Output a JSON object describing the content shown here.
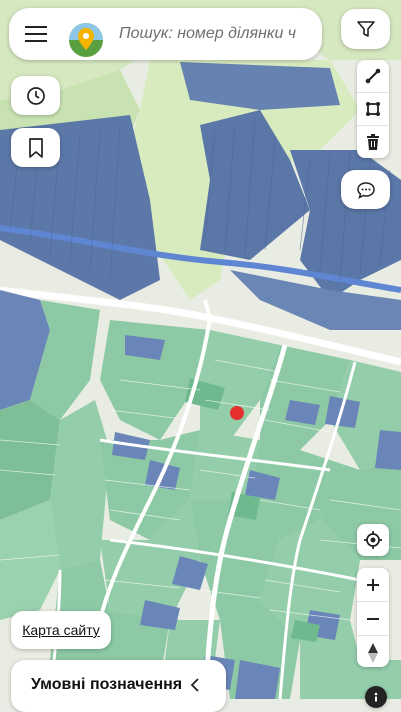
{
  "search": {
    "placeholder": "Пошук: номер ділянки ч"
  },
  "sitemap": {
    "label": "Карта сайту"
  },
  "legend": {
    "label": "Умовні позначення"
  },
  "icons": {
    "menu": "hamburger-icon",
    "logo": "map-logo-icon",
    "filter": "filter-icon",
    "history": "clock-icon",
    "bookmark": "bookmark-icon",
    "measure_line": "line-measure-icon",
    "measure_area": "area-measure-icon",
    "delete": "trash-icon",
    "comment": "chat-icon",
    "locate": "locate-icon",
    "zoom_in": "plus-icon",
    "zoom_out": "minus-icon",
    "compass": "compass-icon",
    "chevron": "chevron-left-icon",
    "marker": "location-marker"
  },
  "colors": {
    "parcel_green": "#8cc9a4",
    "parcel_blue": "#6d84b8",
    "forest": "#4f6fa2",
    "meadow": "#cfe5b3",
    "road": "#ffffff",
    "river": "#5d82cf",
    "marker": "#e63030"
  }
}
